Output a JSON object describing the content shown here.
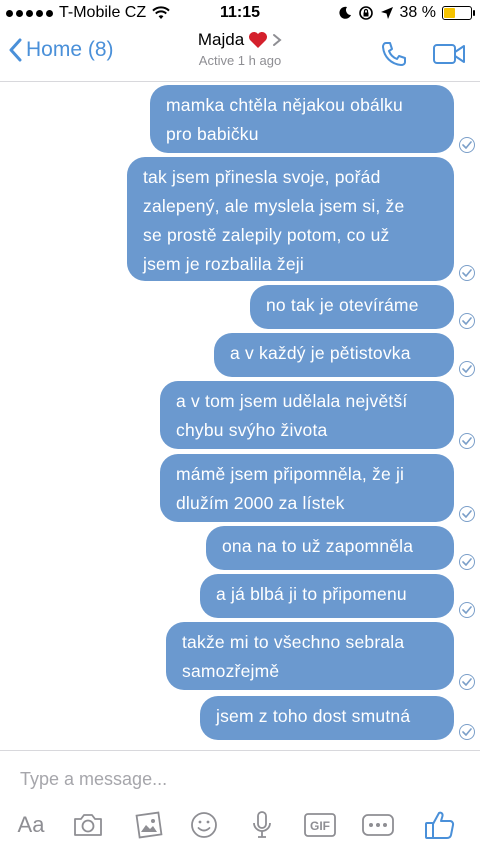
{
  "status_bar": {
    "carrier": "T-Mobile CZ",
    "time": "11:15",
    "battery_percent": "38 %",
    "battery_level": 0.38,
    "battery_color": "#f5c300"
  },
  "nav": {
    "back_label": "Home (8)",
    "contact_name": "Majda",
    "contact_status": "Active 1 h ago",
    "accent_color": "#4a90d9"
  },
  "messages": [
    {
      "text": "mamka chtěla nějakou obálku\npro babičku",
      "sender": "me",
      "status": "sent-check"
    },
    {
      "text": "tak jsem přinesla svoje, pořád\nzalepený, ale myslela jsem si, že\nse prostě zalepily potom, co už\njsem je rozbalila žeji",
      "sender": "me",
      "status": "sent-check"
    },
    {
      "text": "no tak je otevíráme",
      "sender": "me",
      "status": "sent-check"
    },
    {
      "text": "a v každý je pětistovka",
      "sender": "me",
      "status": "sent-check"
    },
    {
      "text": "a v tom jsem udělala největší\nchybu svýho života",
      "sender": "me",
      "status": "sent-check"
    },
    {
      "text": "mámě jsem připomněla, že ji\ndlužím 2000 za lístek",
      "sender": "me",
      "status": "sent-check"
    },
    {
      "text": "ona na to už zapomněla",
      "sender": "me",
      "status": "sent-check"
    },
    {
      "text": "a já blbá ji to připomenu",
      "sender": "me",
      "status": "sent-check"
    },
    {
      "text": "takže mi to všechno sebrala\nsamozřejmě",
      "sender": "me",
      "status": "sent-check"
    },
    {
      "text": "jsem z toho dost smutná",
      "sender": "me",
      "status": "sent-check"
    }
  ],
  "bubble_color": "#6b99cf",
  "composer": {
    "placeholder": "Type a message...",
    "value": "",
    "aa_label": "Aa",
    "gif_label": "GIF",
    "tools": [
      "camera-icon",
      "photo-gallery-icon",
      "emoji-icon",
      "microphone-icon",
      "gif-icon",
      "more-icon",
      "like-icon"
    ]
  }
}
